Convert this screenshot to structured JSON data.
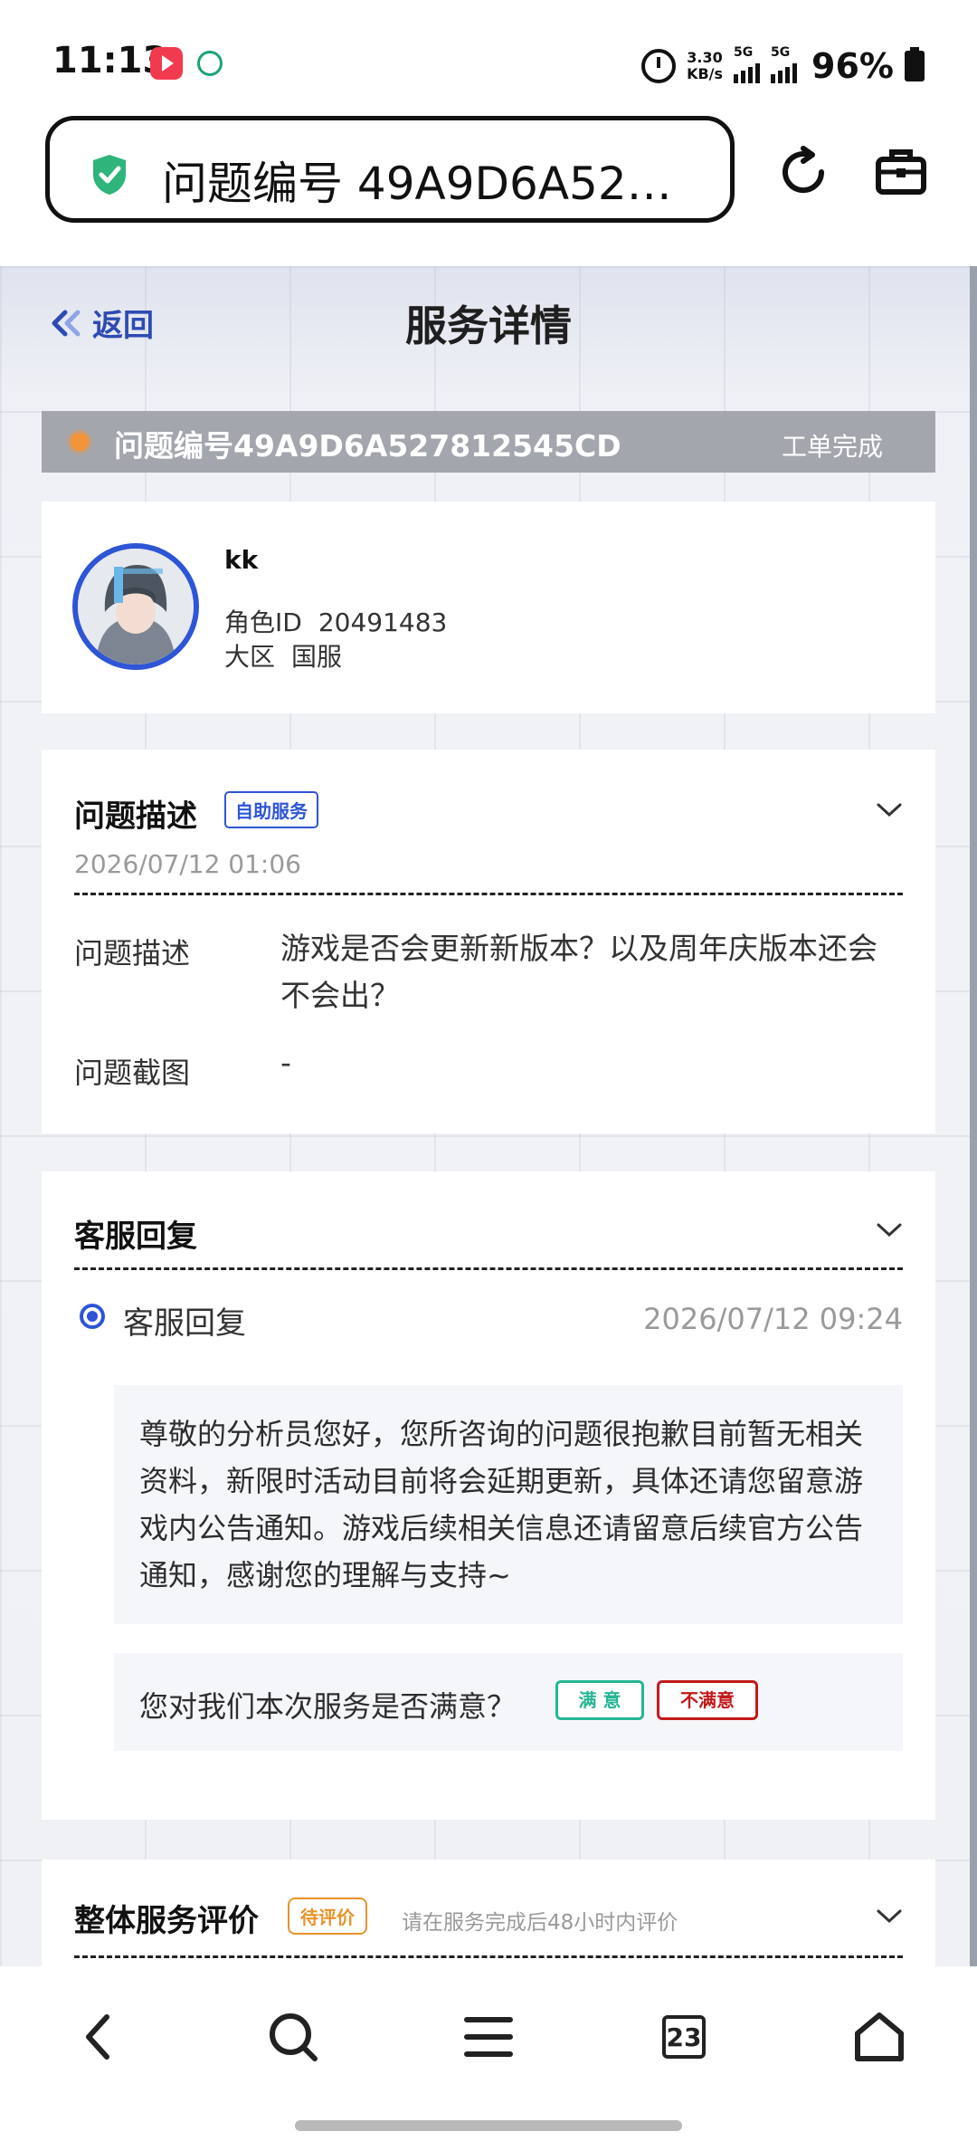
{
  "status_bar": {
    "time": "11:13",
    "net_speed_value": "3.30",
    "net_speed_unit": "KB/s",
    "signal1": "5G",
    "signal2": "5G",
    "battery": "96%"
  },
  "browser": {
    "url_text": "问题编号 49A9D6A527…",
    "icons": [
      "shield-check-icon",
      "refresh-icon",
      "toolbox-icon"
    ]
  },
  "header": {
    "back_label": "返回",
    "title": "服务详情"
  },
  "ticket": {
    "id_text": "问题编号49A9D6A527812545CD",
    "status": "工单完成"
  },
  "profile": {
    "name": "kk",
    "role_id_label": "角色ID",
    "role_id_value": "20491483",
    "region_label": "大区",
    "region_value": "国服"
  },
  "problem": {
    "title": "问题描述",
    "tag": "自助服务",
    "date": "2026/07/12 01:06",
    "desc_label": "问题描述",
    "desc_value": "游戏是否会更新新版本？以及周年庆版本还会不会出？",
    "screenshot_label": "问题截图",
    "screenshot_value": "-"
  },
  "reply": {
    "title": "客服回复",
    "item_label": "客服回复",
    "item_date": "2026/07/12 09:24",
    "text": "尊敬的分析员您好，您所咨询的问题很抱歉目前暂无相关资料，新限时活动目前将会延期更新，具体还请您留意游戏内公告通知。游戏后续相关信息还请留意后续官方公告通知，感谢您的理解与支持~",
    "satisfy_question": "您对我们本次服务是否满意？",
    "satisfied": "满 意",
    "unsatisfied": "不满意"
  },
  "evaluation": {
    "title": "整体服务评价",
    "tag": "待评价",
    "note": "请在服务完成后48小时内评价"
  },
  "bottom_nav": {
    "tab_count": "23",
    "icons": [
      "back-icon",
      "search-icon",
      "menu-icon",
      "tabs-icon",
      "home-icon"
    ]
  },
  "colors": {
    "accent_blue": "#2e55d6",
    "satisfied_green": "#27b595",
    "unsatisfied_red": "#c21a1a",
    "pending_orange": "#e8932a",
    "ticket_bar": "#a3a6ad"
  }
}
